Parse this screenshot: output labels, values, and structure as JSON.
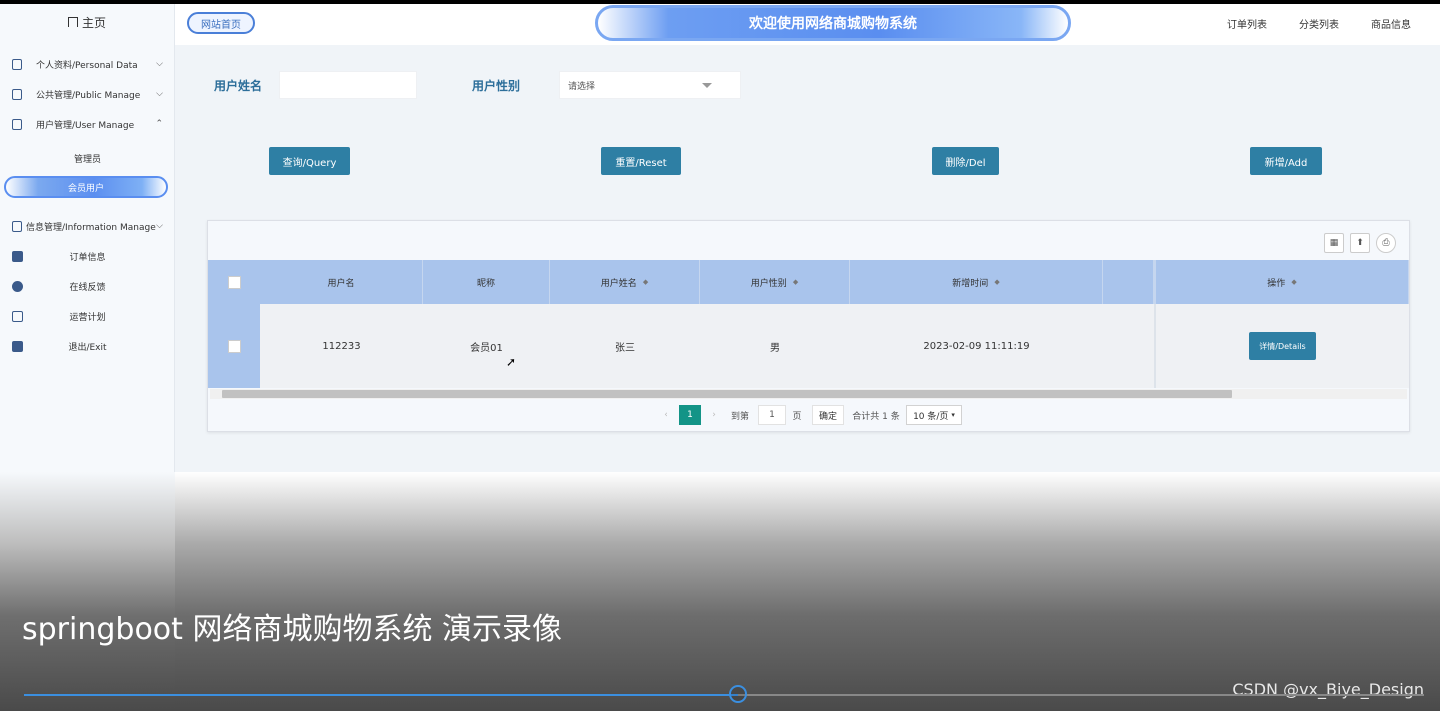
{
  "sidebar": {
    "home": "主页",
    "menus": [
      {
        "label": "个人资料/Personal Data",
        "icon": "document-icon",
        "chevron": "⌵"
      },
      {
        "label": "公共管理/Public Manage",
        "icon": "clipboard-icon",
        "chevron": "⌵"
      },
      {
        "label": "用户管理/User Manage",
        "icon": "bar-chart-icon",
        "chevron": "⌃"
      },
      {
        "label": "信息管理/Information Manage",
        "icon": "chart-icon",
        "chevron": "⌵"
      }
    ],
    "user_sub": [
      "管理员",
      "会员用户"
    ],
    "info_sub": [
      {
        "label": "订单信息",
        "icon": "bookmark-icon"
      },
      {
        "label": "在线反馈",
        "icon": "user-search-icon"
      },
      {
        "label": "运营计划",
        "icon": "calendar-icon"
      },
      {
        "label": "退出/Exit",
        "icon": "calendar-check-icon"
      }
    ]
  },
  "header": {
    "home_button": "网站首页",
    "banner": "欢迎使用网络商城购物系统",
    "links": [
      "订单列表",
      "分类列表",
      "商品信息"
    ]
  },
  "filters": {
    "name_label": "用户姓名",
    "name_value": "",
    "gender_label": "用户性别",
    "gender_placeholder": "请选择"
  },
  "actions": {
    "query": "查询/Query",
    "reset": "重置/Reset",
    "delete": "删除/Del",
    "add": "新增/Add"
  },
  "table": {
    "columns": [
      "用户名",
      "昵称",
      "用户姓名",
      "用户性别",
      "新增时间",
      "",
      "操作"
    ],
    "rows": [
      {
        "username": "112233",
        "nickname": "会员01",
        "name": "张三",
        "gender": "男",
        "created": "2023-02-09 11:11:19",
        "details": "详情/Details"
      }
    ]
  },
  "pager": {
    "current": "1",
    "goto_label": "到第",
    "goto_value": "1",
    "page_unit": "页",
    "confirm": "确定",
    "total": "合计共 1 条",
    "page_size": "10 条/页"
  },
  "video": {
    "caption": "springboot 网络商城购物系统 演示录像",
    "watermark": "CSDN @vx_Biye_Design",
    "progress_fraction": 0.51
  }
}
